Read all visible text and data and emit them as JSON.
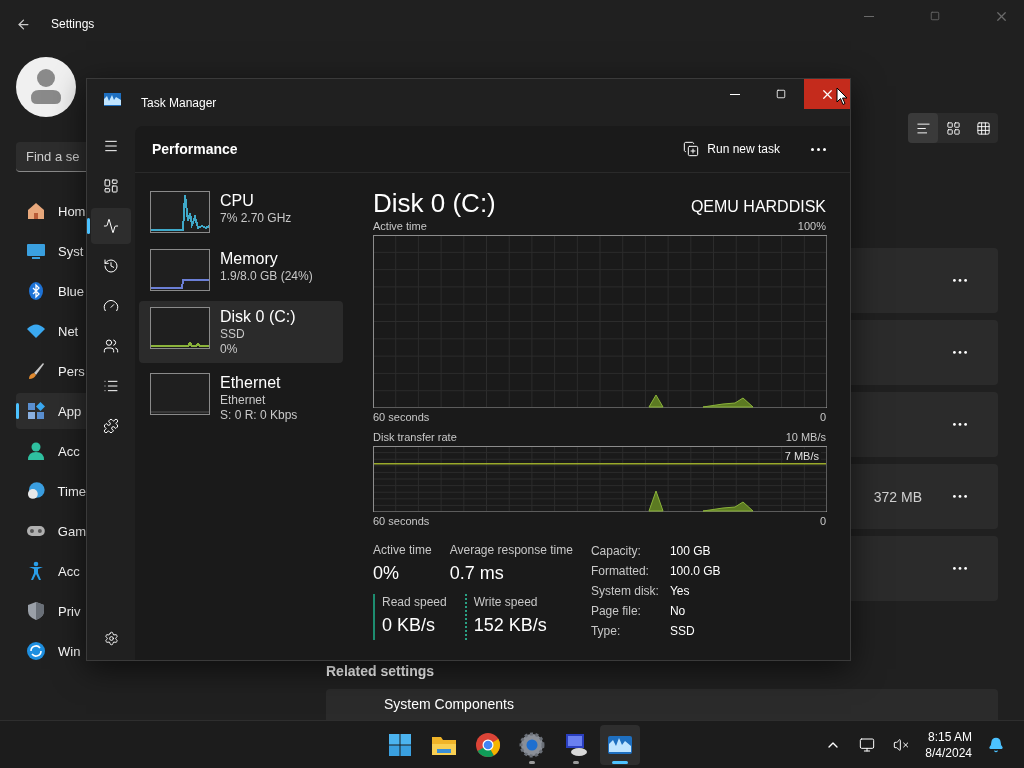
{
  "settings": {
    "title": "Settings",
    "search": {
      "placeholder": "Find a se"
    },
    "nav": [
      {
        "label": "Hom",
        "kind": "home",
        "selected": false
      },
      {
        "label": "Syst",
        "kind": "system",
        "selected": false
      },
      {
        "label": "Blue",
        "kind": "bluetooth",
        "selected": false
      },
      {
        "label": "Net",
        "kind": "network",
        "selected": false
      },
      {
        "label": "Pers",
        "kind": "brush",
        "selected": false
      },
      {
        "label": "App",
        "kind": "apps",
        "selected": true
      },
      {
        "label": "Acc",
        "kind": "person",
        "selected": false
      },
      {
        "label": "Time",
        "kind": "clock",
        "selected": false
      },
      {
        "label": "Gam",
        "kind": "gamepad",
        "selected": false
      },
      {
        "label": "Acc",
        "kind": "accessibility",
        "selected": false
      },
      {
        "label": "Priv",
        "kind": "shield",
        "selected": false
      },
      {
        "label": "Win",
        "kind": "update",
        "selected": false
      }
    ],
    "view_modes": [
      {
        "kind": "list",
        "selected": true
      },
      {
        "kind": "tiles",
        "selected": false
      },
      {
        "kind": "grid",
        "selected": false
      }
    ],
    "app_cards": [
      {
        "kind": "app"
      },
      {
        "kind": "app"
      },
      {
        "kind": "app"
      },
      {
        "kind": "app",
        "size": "372 MB"
      },
      {
        "kind": "app"
      }
    ],
    "related": {
      "heading": "Related settings",
      "items": [
        "System Components"
      ]
    }
  },
  "task_manager": {
    "title": "Task Manager",
    "controls": [
      {
        "kind": "minimize",
        "hovered": false
      },
      {
        "kind": "maximize",
        "hovered": false
      },
      {
        "kind": "close",
        "hovered": true
      }
    ],
    "rail": [
      {
        "kind": "menu",
        "selected": false
      },
      {
        "kind": "processes",
        "selected": false
      },
      {
        "kind": "performance",
        "selected": true
      },
      {
        "kind": "history",
        "selected": false
      },
      {
        "kind": "startup",
        "selected": false
      },
      {
        "kind": "users",
        "selected": false
      },
      {
        "kind": "details",
        "selected": false
      },
      {
        "kind": "services",
        "selected": false
      }
    ],
    "page": "Performance",
    "run_task": "Run new task",
    "devices": [
      {
        "name": "CPU",
        "details": [
          "7% 2.70 GHz"
        ],
        "kind": "cpu",
        "color": "#3fa9c9",
        "selected": false
      },
      {
        "name": "Memory",
        "details": [
          "1.9/8.0 GB (24%)"
        ],
        "kind": "memory",
        "color": "#6b7fd6",
        "selected": false
      },
      {
        "name": "Disk 0 (C:)",
        "details": [
          "SSD",
          "0%"
        ],
        "kind": "disk",
        "color": "#8bb33a",
        "selected": true
      },
      {
        "name": "Ethernet",
        "details": [
          "Ethernet",
          "S: 0 R: 0 Kbps"
        ],
        "kind": "ethernet",
        "selected": false
      }
    ],
    "detail": {
      "title": "Disk 0 (C:)",
      "model": "QEMU HARDDISK",
      "charts": [
        {
          "label": "Active time",
          "max": "100%",
          "span": "60 seconds",
          "min": "0"
        },
        {
          "label": "Disk transfer rate",
          "max": "10 MB/s",
          "marker": "7 MB/s",
          "span": "60 seconds",
          "min": "0"
        }
      ],
      "stats": [
        {
          "label": "Active time",
          "value": "0%"
        },
        {
          "label": "Average response time",
          "value": "0.7 ms"
        }
      ],
      "speeds": [
        {
          "label": "Read speed",
          "value": "0 KB/s",
          "kind": "solid"
        },
        {
          "label": "Write speed",
          "value": "152 KB/s",
          "kind": "dashed"
        }
      ],
      "properties": [
        {
          "key": "Capacity:",
          "value": "100 GB"
        },
        {
          "key": "Formatted:",
          "value": "100.0 GB"
        },
        {
          "key": "System disk:",
          "value": "Yes"
        },
        {
          "key": "Page file:",
          "value": "No"
        },
        {
          "key": "Type:",
          "value": "SSD"
        }
      ]
    }
  },
  "taskbar": {
    "apps": [
      {
        "kind": "start",
        "running": false,
        "active": false
      },
      {
        "kind": "folder",
        "running": false,
        "active": false
      },
      {
        "kind": "browser",
        "running": false,
        "active": false
      },
      {
        "kind": "gear",
        "running": true,
        "active": false
      },
      {
        "kind": "remote",
        "running": true,
        "active": false
      },
      {
        "kind": "taskmanager",
        "running": true,
        "active": true
      }
    ],
    "time": "8:15 AM",
    "date": "8/4/2024"
  }
}
